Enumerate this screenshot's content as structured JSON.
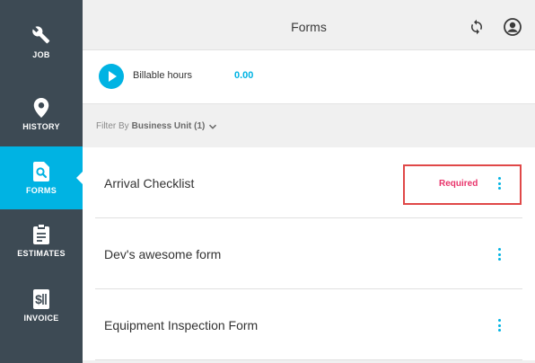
{
  "sidebar": {
    "items": [
      {
        "label": "JOB",
        "icon": "wrench-icon"
      },
      {
        "label": "HISTORY",
        "icon": "location-pin-icon"
      },
      {
        "label": "FORMS",
        "icon": "form-search-icon",
        "active": true
      },
      {
        "label": "ESTIMATES",
        "icon": "clipboard-icon"
      },
      {
        "label": "INVOICE",
        "icon": "invoice-dollar-icon"
      }
    ]
  },
  "header": {
    "title": "Forms",
    "sync_icon": "sync-icon",
    "account_icon": "account-icon"
  },
  "billable": {
    "label": "Billable hours",
    "value": "0.00"
  },
  "filter": {
    "prefix": "Filter By",
    "value": "Business Unit (1)"
  },
  "forms": [
    {
      "name": "Arrival Checklist",
      "badge": "Required"
    },
    {
      "name": "Dev's awesome form",
      "badge": ""
    },
    {
      "name": "Equipment Inspection Form",
      "badge": ""
    }
  ],
  "colors": {
    "accent": "#00b3e3",
    "sidebar": "#3d4a54",
    "required": "#e8336a",
    "highlight": "#e04848"
  }
}
